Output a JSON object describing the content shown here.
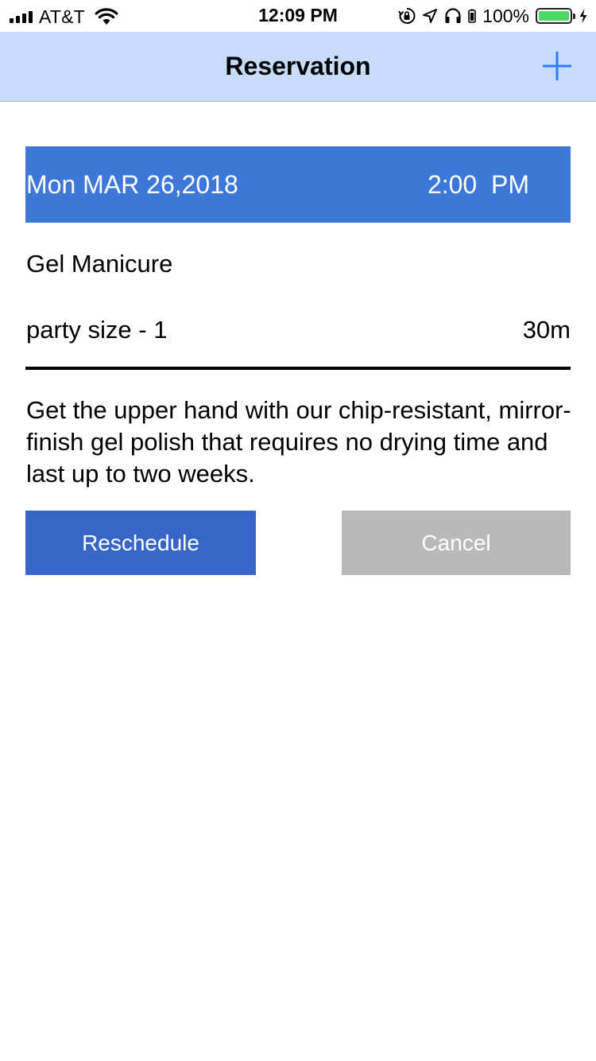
{
  "status_bar": {
    "carrier": "AT&T",
    "time": "12:09 PM",
    "battery_percent": "100%",
    "icons": [
      "signal-icon",
      "wifi-icon",
      "orientation-lock-icon",
      "location-icon",
      "headphones-icon",
      "battery-icon",
      "charging-icon"
    ]
  },
  "nav": {
    "title": "Reservation",
    "add_icon": "plus-icon"
  },
  "reservation": {
    "date": "Mon MAR 26,2018",
    "time": "2:00  PM",
    "service": "Gel Manicure",
    "party_size": "party size - 1",
    "duration": "30m",
    "description": "Get the upper hand with our chip-resistant, mirror-finish gel polish that requires no drying time and last up to two weeks."
  },
  "actions": {
    "reschedule_label": "Reschedule",
    "cancel_label": "Cancel"
  },
  "colors": {
    "nav_background": "#c7dcfb",
    "accent_blue": "#2f7bf5",
    "date_bar": "#3d78d8",
    "reschedule_button": "#3766c7",
    "cancel_button": "#b9b9b9",
    "battery_fill": "#4cd964"
  }
}
